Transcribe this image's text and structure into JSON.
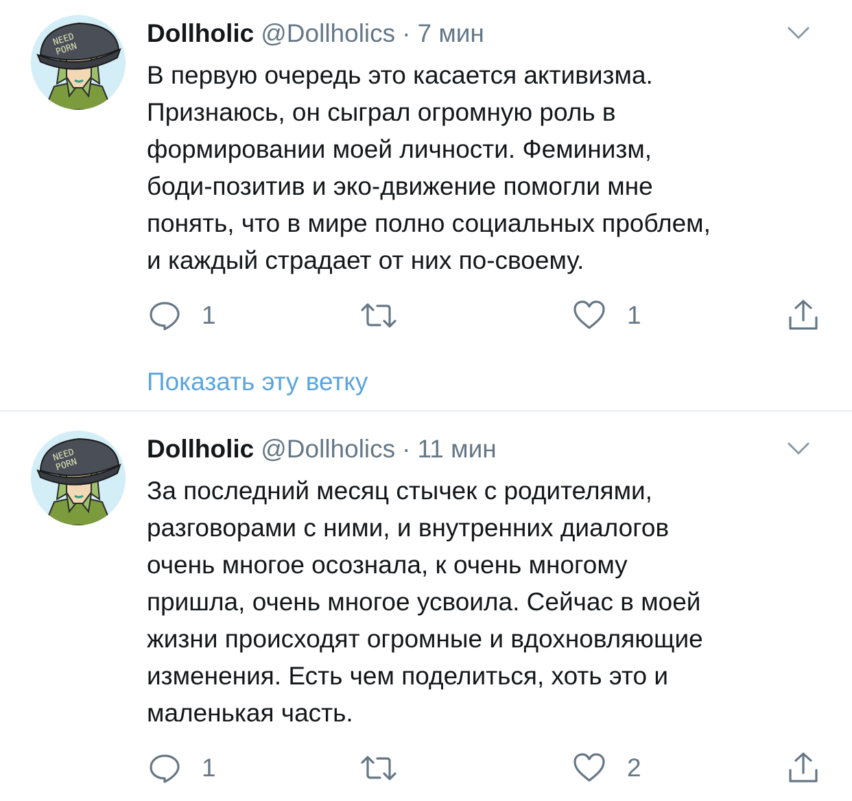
{
  "colors": {
    "accent": "#1da1f2",
    "text_primary": "#14171a",
    "text_secondary": "#657786",
    "divider": "#e6ecf0"
  },
  "tweets": [
    {
      "display_name": "Dollholic",
      "handle": "@Dollholics",
      "separator": "·",
      "time": "7 мин",
      "text_lines": [
        "В первую очередь это касается активизма.",
        "Признаюсь, он сыграл огромную роль в",
        "формировании моей личности. Феминизм,",
        "боди-позитив и эко-движение помогли мне",
        "понять, что в мире полно социальных проблем,",
        "и каждый страдает от них по-своему."
      ],
      "reply_count": "1",
      "retweet_count": "",
      "like_count": "1",
      "icons": {
        "reply": "speech-bubble-icon",
        "retweet": "retweet-icon",
        "like": "heart-icon",
        "share": "share-icon",
        "menu": "chevron-down-icon"
      },
      "show_thread_label": "Показать эту ветку"
    },
    {
      "display_name": "Dollholic",
      "handle": "@Dollholics",
      "separator": "·",
      "time": "11 мин",
      "text_lines": [
        "За последний месяц стычек с родителями,",
        "разговорами с ними, и внутренних диалогов",
        "очень многое осознала, к очень многому",
        "пришла, очень многое усвоила. Сейчас в моей",
        "жизни происходят огромные и вдохновляющие",
        "изменения. Есть чем поделиться, хоть это и",
        "маленькая часть."
      ],
      "reply_count": "1",
      "retweet_count": "",
      "like_count": "2",
      "icons": {
        "reply": "speech-bubble-icon",
        "retweet": "retweet-icon",
        "like": "heart-icon",
        "share": "share-icon",
        "menu": "chevron-down-icon"
      }
    }
  ],
  "avatar": {
    "cap_text_line1": "NEED",
    "cap_text_line2": "PORN"
  }
}
